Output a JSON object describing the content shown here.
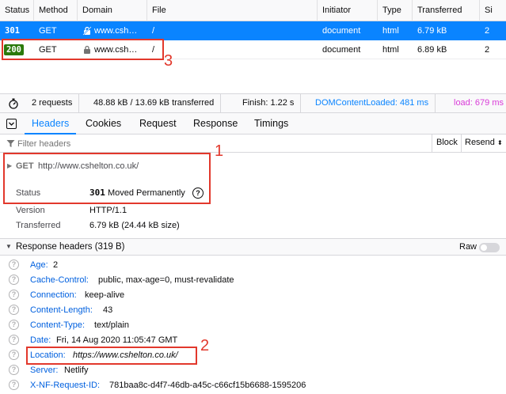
{
  "table": {
    "columns": [
      "Status",
      "Method",
      "Domain",
      "File",
      "Initiator",
      "Type",
      "Transferred",
      "Si"
    ],
    "rows": [
      {
        "status": "301",
        "method": "GET",
        "domain": "www.csh…",
        "file": "/",
        "initiator": "document",
        "type": "html",
        "transferred": "6.79 kB",
        "size": "2"
      },
      {
        "status": "200",
        "method": "GET",
        "domain": "www.csh…",
        "file": "/",
        "initiator": "document",
        "type": "html",
        "transferred": "6.89 kB",
        "size": "2"
      }
    ]
  },
  "summary": {
    "requests": "2 requests",
    "bytes": "48.88 kB / 13.69 kB transferred",
    "finish": "Finish: 1.22 s",
    "domcontentloaded": "DOMContentLoaded: 481 ms",
    "load": "load: 679 ms"
  },
  "tabs": [
    "Headers",
    "Cookies",
    "Request",
    "Response",
    "Timings"
  ],
  "filter": {
    "placeholder": "Filter headers",
    "block_label": "Block",
    "resend_label": "Resend"
  },
  "request": {
    "method": "GET",
    "url": "http://www.cshelton.co.uk/",
    "status_label": "Status",
    "status_code": "301",
    "status_text": "Moved Permanently",
    "version_label": "Version",
    "version": "HTTP/1.1",
    "transferred_label": "Transferred",
    "transferred": "6.79 kB (24.44 kB size)"
  },
  "response_headers": {
    "title": "Response headers (319 B)",
    "raw_label": "Raw",
    "items": [
      {
        "name": "Age:",
        "value": "2"
      },
      {
        "name": "Cache-Control:",
        "value": "public, max-age=0, must-revalidate"
      },
      {
        "name": "Connection:",
        "value": "keep-alive"
      },
      {
        "name": "Content-Length:",
        "value": "43"
      },
      {
        "name": "Content-Type:",
        "value": "text/plain"
      },
      {
        "name": "Date:",
        "value": "Fri, 14 Aug 2020 11:05:47 GMT"
      },
      {
        "name": "Location:",
        "value": "https://www.cshelton.co.uk/"
      },
      {
        "name": "Server:",
        "value": "Netlify"
      },
      {
        "name": "X-NF-Request-ID:",
        "value": "781baa8c-d4f7-46db-a45c-c66cf15b6688-1595206"
      }
    ]
  },
  "annotations": [
    "1",
    "2",
    "3"
  ],
  "colors": {
    "selected_row": "#0a84ff",
    "accent": "#0a84ff",
    "annotation": "#e2382c",
    "badge_200": "#2b7a0b",
    "load": "#d93bd8"
  }
}
